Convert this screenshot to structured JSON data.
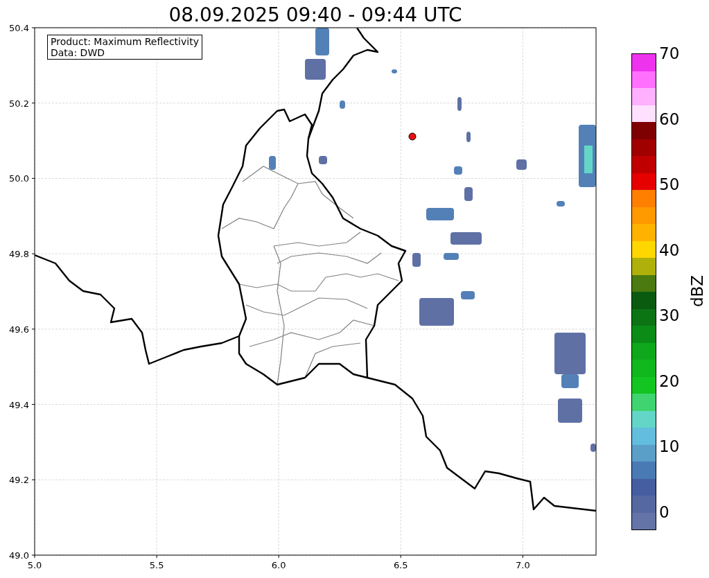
{
  "title": "08.09.2025 09:40 - 09:44 UTC",
  "map": {
    "info_lines": [
      "Product: Maximum Reflectivity",
      "Data: DWD"
    ],
    "xticks": [
      "5.0",
      "5.5",
      "6.0",
      "6.5",
      "7.0"
    ],
    "yticks": [
      "50.4",
      "50.2",
      "50.0",
      "49.8",
      "49.6",
      "49.4",
      "49.2",
      "49.0"
    ]
  },
  "colorbar": {
    "label": "dBZ",
    "ticks": [
      "70",
      "60",
      "50",
      "40",
      "30",
      "20",
      "10",
      "0"
    ],
    "segments": [
      {
        "color": "#6474a6"
      },
      {
        "color": "#5668a0"
      },
      {
        "color": "#445ea0"
      },
      {
        "color": "#4a7ab3"
      },
      {
        "color": "#5b9ec8"
      },
      {
        "color": "#63bddc"
      },
      {
        "color": "#63d6c7"
      },
      {
        "color": "#3fd46f"
      },
      {
        "color": "#13c520"
      },
      {
        "color": "#10b81e"
      },
      {
        "color": "#0fa81c"
      },
      {
        "color": "#0b8c17"
      },
      {
        "color": "#0c7414"
      },
      {
        "color": "#0a5b10"
      },
      {
        "color": "#4a7a10"
      },
      {
        "color": "#b0b00a"
      },
      {
        "color": "#ffd700"
      },
      {
        "color": "#ffb300"
      },
      {
        "color": "#ff9900"
      },
      {
        "color": "#ff7f00"
      },
      {
        "color": "#e60000"
      },
      {
        "color": "#c00000"
      },
      {
        "color": "#a00000"
      },
      {
        "color": "#7f0000"
      },
      {
        "color": "#ffe0ff"
      },
      {
        "color": "#ffb0ff"
      },
      {
        "color": "#ff70ff"
      },
      {
        "color": "#ee33ee"
      }
    ]
  }
}
